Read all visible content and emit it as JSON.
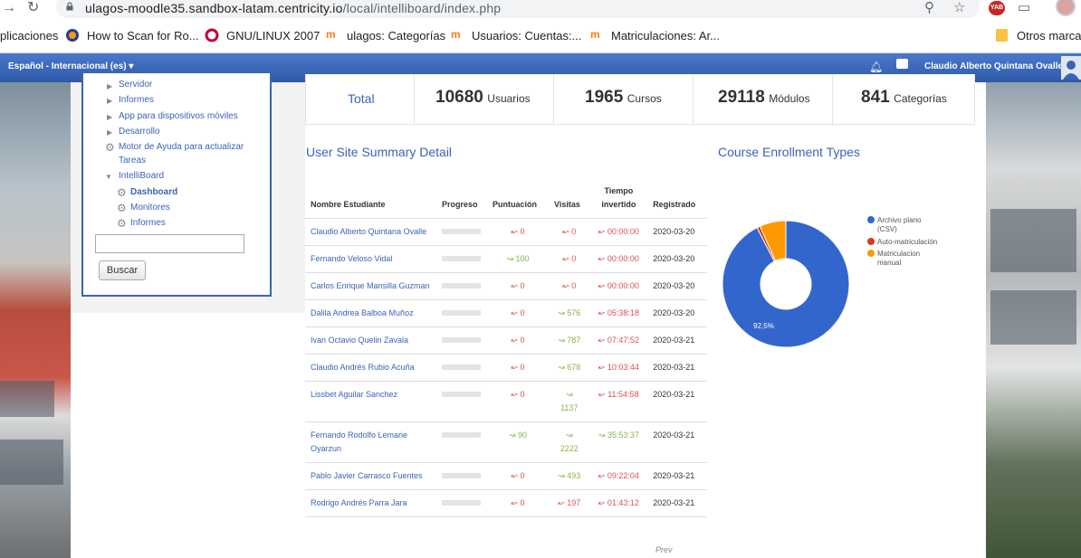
{
  "browser": {
    "url_host": "ulagos-moodle35.sandbox-latam.centricity.io",
    "url_path": "/local/intelliboard/index.php",
    "extension_badge": "YAB",
    "bookmarks": [
      {
        "label": "plicaciones"
      },
      {
        "label": "How to Scan for Ro..."
      },
      {
        "label": "GNU/LINUX 2007"
      },
      {
        "label": "ulagos: Categorías"
      },
      {
        "label": "Usuarios: Cuentas:..."
      },
      {
        "label": "Matriculaciones: Ar..."
      },
      {
        "label": "Otros marcad"
      }
    ]
  },
  "navbar": {
    "language": "Español - Internacional (es) ▾",
    "user_name": "Claudio Alberto Quintana Ovalle"
  },
  "admin_tree": {
    "items": [
      {
        "label": "Servidor"
      },
      {
        "label": "Informes"
      },
      {
        "label": "App para dispositivos móviles"
      },
      {
        "label": "Desarrollo"
      },
      {
        "label": "Motor de Ayuda para actualizar"
      },
      {
        "label": "Tareas"
      },
      {
        "label": "IntelliBoard"
      },
      {
        "label": "Dashboard"
      },
      {
        "label": "Monitores"
      },
      {
        "label": "Informes"
      }
    ],
    "search_value": "",
    "search_button": "Buscar"
  },
  "stats": {
    "total_label": "Total",
    "users": {
      "value": "10680",
      "label": "Usuarios"
    },
    "courses": {
      "value": "1965",
      "label": "Cursos"
    },
    "modules": {
      "value": "29118",
      "label": "Módulos"
    },
    "categories": {
      "value": "841",
      "label": "Categorías"
    }
  },
  "summary": {
    "title": "User Site Summary Detail",
    "headers": {
      "name": "Nombre Estudiante",
      "progress": "Progreso",
      "score": "Puntuación",
      "visits": "Visitas",
      "time_1": "Tiempo",
      "time_2": "invertido",
      "registered": "Registrado"
    },
    "rows": [
      {
        "name": "Claudio Alberto Quintana Ovalle",
        "progress": 0,
        "score": "0",
        "score_dir": "down",
        "visits": "0",
        "visits_dir": "down",
        "time": "00:00:00",
        "time_dir": "down",
        "registered": "2020-03-20"
      },
      {
        "name": "Fernando Veloso Vidal",
        "progress": 0,
        "score": "100",
        "score_dir": "up",
        "visits": "0",
        "visits_dir": "down",
        "time": "00:00:00",
        "time_dir": "down",
        "registered": "2020-03-20"
      },
      {
        "name": "Carlos Enrique Mansilla Guzman",
        "progress": 0,
        "score": "0",
        "score_dir": "down",
        "visits": "0",
        "visits_dir": "down",
        "time": "00:00:00",
        "time_dir": "down",
        "registered": "2020-03-20"
      },
      {
        "name": "Dalila Andrea Balboa Muñoz",
        "progress": 0,
        "score": "0",
        "score_dir": "down",
        "visits": "576",
        "visits_dir": "up",
        "time": "05:38:18",
        "time_dir": "down",
        "registered": "2020-03-20"
      },
      {
        "name": "Ivan Octavio Quelin Zavala",
        "progress": 0,
        "score": "0",
        "score_dir": "down",
        "visits": "787",
        "visits_dir": "up",
        "time": "07:47:52",
        "time_dir": "down",
        "registered": "2020-03-21"
      },
      {
        "name": "Claudio Andrés Rubio Acuña",
        "progress": 0,
        "score": "0",
        "score_dir": "down",
        "visits": "678",
        "visits_dir": "up",
        "time": "10:03:44",
        "time_dir": "down",
        "registered": "2020-03-21"
      },
      {
        "name": "Lissbet Aguilar Sanchez",
        "progress": 0,
        "score": "0",
        "score_dir": "down",
        "visits": "1137",
        "visits_dir": "up",
        "time": "11:54:58",
        "time_dir": "down",
        "registered": "2020-03-21"
      },
      {
        "name": "Fernando Rodolfo Lemarie Oyarzun",
        "progress": 0,
        "score": "90",
        "score_dir": "up",
        "visits": "2222",
        "visits_dir": "up",
        "time": "35:53:37",
        "time_dir": "up",
        "registered": "2020-03-21"
      },
      {
        "name": "Pablo Javier Carrasco Fuentes",
        "progress": 0,
        "score": "0",
        "score_dir": "down",
        "visits": "493",
        "visits_dir": "up",
        "time": "09:22:04",
        "time_dir": "down",
        "registered": "2020-03-21"
      },
      {
        "name": "Rodrigo Andrés Parra Jara",
        "progress": 0,
        "score": "0",
        "score_dir": "down",
        "visits": "197",
        "visits_dir": "down",
        "time": "01:43:12",
        "time_dir": "down",
        "registered": "2020-03-21"
      }
    ],
    "prev_label": "Prev"
  },
  "chart_data": {
    "type": "pie",
    "title": "Course Enrollment Types",
    "donut": true,
    "legend_position": "right",
    "categories": [
      "Archivo plano (CSV)",
      "Auto-matriculación",
      "Matriculacion manual"
    ],
    "values": [
      92.5,
      0.8,
      6.7
    ],
    "colors": [
      "#3366cc",
      "#dc3912",
      "#ff9900"
    ],
    "data_labels": [
      "92,5%",
      "",
      ""
    ]
  }
}
